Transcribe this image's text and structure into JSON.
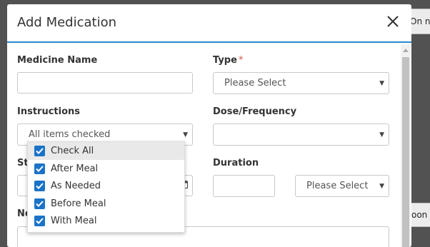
{
  "background": {
    "top_strip_text": "On n",
    "mid_strip_text": "oon"
  },
  "modal": {
    "title": "Add Medication",
    "close_icon": "close-icon"
  },
  "form": {
    "medicine_name": {
      "label": "Medicine Name",
      "value": "",
      "placeholder": ""
    },
    "type": {
      "label": "Type",
      "required_mark": "*",
      "selected": "Please Select"
    },
    "instructions": {
      "label": "Instructions",
      "selected": "All items checked",
      "options": [
        {
          "label": "Check All",
          "checked": true
        },
        {
          "label": "After Meal",
          "checked": true
        },
        {
          "label": "As Needed",
          "checked": true
        },
        {
          "label": "Before Meal",
          "checked": true
        },
        {
          "label": "With Meal",
          "checked": true
        }
      ]
    },
    "dose_frequency": {
      "label": "Dose/Frequency",
      "selected": ""
    },
    "start_label_partial": "St",
    "duration": {
      "label": "Duration",
      "value": "",
      "unit_selected": "Please Select"
    },
    "notes_label_partial": "No"
  },
  "colors": {
    "accent": "#2b8acb",
    "checkbox": "#1a73c8",
    "required": "#d9534f",
    "overlay": "#525252"
  }
}
